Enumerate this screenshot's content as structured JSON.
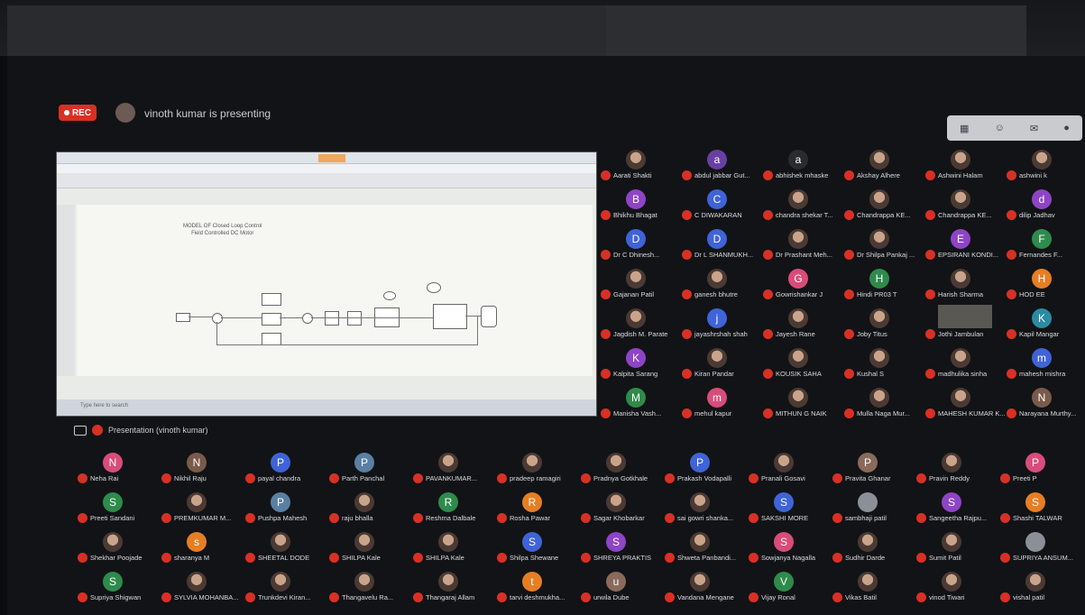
{
  "recording_badge": "REC",
  "presenter_text": "vinoth kumar is presenting",
  "presentation_label": "Presentation (vinoth kumar)",
  "colors": {
    "red": "#d93025",
    "purple": "#8e44c6",
    "blue": "#3f63d8",
    "green": "#2e8b4b",
    "orange": "#e67e22",
    "pink": "#d94c7a",
    "teal": "#2a8ba3",
    "grey": "#8a8f98"
  },
  "top_controls": [
    "grid-icon",
    "people-icon",
    "chat-icon",
    "avatar-icon"
  ],
  "right_grid": [
    {
      "name": "Aarati Shakti",
      "initial": "",
      "color": "photo"
    },
    {
      "name": "abdul jabbar Gut...",
      "initial": "a",
      "color": "#6a3fa3"
    },
    {
      "name": "abhishek mhaske",
      "initial": "a",
      "color": "#2a2b2e"
    },
    {
      "name": "Akshay Alhere",
      "initial": "",
      "color": "photo"
    },
    {
      "name": "Ashwini Halam",
      "initial": "",
      "color": "photo"
    },
    {
      "name": "ashwini k",
      "initial": "",
      "color": "photo"
    },
    {
      "name": "Bhikhu Bhagat",
      "initial": "B",
      "color": "#8e44c6"
    },
    {
      "name": "C DIWAKARAN",
      "initial": "C",
      "color": "#3f63d8"
    },
    {
      "name": "chandra shekar T...",
      "initial": "",
      "color": "photo"
    },
    {
      "name": "Chandrappa KE...",
      "initial": "",
      "color": "photo"
    },
    {
      "name": "Chandrappa KE...",
      "initial": "",
      "color": "photo"
    },
    {
      "name": "dilip Jadhav",
      "initial": "d",
      "color": "#8e44c6"
    },
    {
      "name": "Dr C Dhinesh...",
      "initial": "D",
      "color": "#3f63d8"
    },
    {
      "name": "Dr L SHANMUKH...",
      "initial": "D",
      "color": "#3f63d8"
    },
    {
      "name": "Dr Prashant Meh...",
      "initial": "",
      "color": "photo"
    },
    {
      "name": "Dr Shilpa Pankaj ...",
      "initial": "",
      "color": "photo"
    },
    {
      "name": "EPSIRANI KONDI...",
      "initial": "E",
      "color": "#8e44c6"
    },
    {
      "name": "Fernandes F...",
      "initial": "F",
      "color": "#2e8b4b"
    },
    {
      "name": "Gajanan Patil",
      "initial": "",
      "color": "photo"
    },
    {
      "name": "ganesh bhutre",
      "initial": "",
      "color": "photo"
    },
    {
      "name": "Gowrishankar J",
      "initial": "G",
      "color": "#d94c7a"
    },
    {
      "name": "Hindi PR03 T",
      "initial": "H",
      "color": "#2e8b4b"
    },
    {
      "name": "Harish Sharma",
      "initial": "",
      "color": "photo"
    },
    {
      "name": "HOD EE",
      "initial": "H",
      "color": "#e67e22"
    },
    {
      "name": "Jagdish M. Parate",
      "initial": "",
      "color": "photo"
    },
    {
      "name": "jayashrshah shah",
      "initial": "j",
      "color": "#3f63d8"
    },
    {
      "name": "Jayesh Rane",
      "initial": "",
      "color": "photo"
    },
    {
      "name": "Joby Titus",
      "initial": "",
      "color": "photo"
    },
    {
      "name": "Jothi Jambulan",
      "initial": "",
      "color": "wide"
    },
    {
      "name": "Kapil Mangar",
      "initial": "K",
      "color": "#2a8ba3"
    },
    {
      "name": "Kalpita Sarang",
      "initial": "K",
      "color": "#8e44c6"
    },
    {
      "name": "Kiran Pandar",
      "initial": "",
      "color": "photo"
    },
    {
      "name": "KOUSIK SAHA",
      "initial": "",
      "color": "photo"
    },
    {
      "name": "Kushal S",
      "initial": "",
      "color": "photo"
    },
    {
      "name": "madhulika sinha",
      "initial": "",
      "color": "photo"
    },
    {
      "name": "mahesh mishra",
      "initial": "m",
      "color": "#3f63d8"
    },
    {
      "name": "Manisha Vash...",
      "initial": "M",
      "color": "#2e8b4b"
    },
    {
      "name": "mehul kapur",
      "initial": "m",
      "color": "#d94c7a"
    },
    {
      "name": "MITHUN G NAIK",
      "initial": "",
      "color": "photo"
    },
    {
      "name": "Mulla Naga Mur...",
      "initial": "",
      "color": "photo"
    },
    {
      "name": "MAHESH KUMAR K...",
      "initial": "",
      "color": "photo"
    },
    {
      "name": "Narayana Murthy...",
      "initial": "N",
      "color": "#7a5a4a"
    }
  ],
  "bottom_grid": [
    {
      "name": "Neha Rai",
      "initial": "N",
      "color": "#d94c7a"
    },
    {
      "name": "Nikhil Raju",
      "initial": "N",
      "color": "#7a5a4a"
    },
    {
      "name": "payal chandra",
      "initial": "P",
      "color": "#3f63d8"
    },
    {
      "name": "Parth Panchal",
      "initial": "P",
      "color": "#5a7fa3"
    },
    {
      "name": "PAVANKUMAR...",
      "initial": "",
      "color": "photo"
    },
    {
      "name": "pradeep ramagiri",
      "initial": "",
      "color": "photo"
    },
    {
      "name": "Pradnya Gotkhale",
      "initial": "",
      "color": "photo"
    },
    {
      "name": "Prakash Vodapalli",
      "initial": "P",
      "color": "#3f63d8"
    },
    {
      "name": "Pranali Gosavi",
      "initial": "",
      "color": "photo"
    },
    {
      "name": "Pravita Ghanar",
      "initial": "P",
      "color": "#8a6a5a"
    },
    {
      "name": "Pravin Reddy",
      "initial": "",
      "color": "photo"
    },
    {
      "name": "Preeti P",
      "initial": "P",
      "color": "#d94c7a"
    },
    {
      "name": "Preeti Sandani",
      "initial": "S",
      "color": "#2e8b4b"
    },
    {
      "name": "PREMKUMAR M...",
      "initial": "",
      "color": "photo"
    },
    {
      "name": "Pushpa Mahesh",
      "initial": "P",
      "color": "#5a7fa3"
    },
    {
      "name": "raju bhalla",
      "initial": "",
      "color": "photo"
    },
    {
      "name": "Reshma Dalbale",
      "initial": "R",
      "color": "#2e8b4b"
    },
    {
      "name": "Rosha Pawar",
      "initial": "R",
      "color": "#e67e22"
    },
    {
      "name": "Sagar Khobarkar",
      "initial": "",
      "color": "photo"
    },
    {
      "name": "sai gowri shanka...",
      "initial": "",
      "color": "photo"
    },
    {
      "name": "SAKSHI MORE",
      "initial": "S",
      "color": "#3f63d8"
    },
    {
      "name": "sambhaji patil",
      "initial": "",
      "color": "grey"
    },
    {
      "name": "Sangeetha Rajpu...",
      "initial": "S",
      "color": "#8e44c6"
    },
    {
      "name": "Shashi TALWAR",
      "initial": "S",
      "color": "#e67e22"
    },
    {
      "name": "Shekhar Poojade",
      "initial": "",
      "color": "photo"
    },
    {
      "name": "sharanya M",
      "initial": "s",
      "color": "#e67e22"
    },
    {
      "name": "SHEETAL DODE",
      "initial": "",
      "color": "photo"
    },
    {
      "name": "SHILPA Kale",
      "initial": "",
      "color": "photo"
    },
    {
      "name": "SHILPA Kale",
      "initial": "",
      "color": "photo"
    },
    {
      "name": "Shilpa Shewane",
      "initial": "S",
      "color": "#3f63d8"
    },
    {
      "name": "SHREYA PRAKTIS",
      "initial": "S",
      "color": "#8e44c6"
    },
    {
      "name": "Shweta Panbandi...",
      "initial": "",
      "color": "photo"
    },
    {
      "name": "Sowjanya Nagalla",
      "initial": "S",
      "color": "#d94c7a"
    },
    {
      "name": "Sudhir Darde",
      "initial": "",
      "color": "photo"
    },
    {
      "name": "Sumit Patil",
      "initial": "",
      "color": "photo"
    },
    {
      "name": "SUPRIYA ANSUM...",
      "initial": "",
      "color": "grey"
    },
    {
      "name": "Supriya Shigwan",
      "initial": "S",
      "color": "#2e8b4b"
    },
    {
      "name": "SYLVIA MOHANBA...",
      "initial": "",
      "color": "photo"
    },
    {
      "name": "Trunkdevi Kiran...",
      "initial": "",
      "color": "photo"
    },
    {
      "name": "Thangavelu Ra...",
      "initial": "",
      "color": "photo"
    },
    {
      "name": "Thangaraj Allam",
      "initial": "",
      "color": "photo"
    },
    {
      "name": "tarvi deshmukha...",
      "initial": "t",
      "color": "#e67e22"
    },
    {
      "name": "urwila Dube",
      "initial": "u",
      "color": "#8a6a5a"
    },
    {
      "name": "Vandana Mengane",
      "initial": "",
      "color": "photo"
    },
    {
      "name": "Vijay Ronal",
      "initial": "V",
      "color": "#2e8b4b"
    },
    {
      "name": "Vikas Batil",
      "initial": "",
      "color": "photo"
    },
    {
      "name": "vinod Tiwari",
      "initial": "",
      "color": "photo"
    },
    {
      "name": "vishal patil",
      "initial": "",
      "color": "photo"
    }
  ],
  "diagram": {
    "title_line1": "MODEL OF Closed Loop Control",
    "title_line2": "Field Controlled DC Motor"
  },
  "taskbar_search": "Type here to search"
}
